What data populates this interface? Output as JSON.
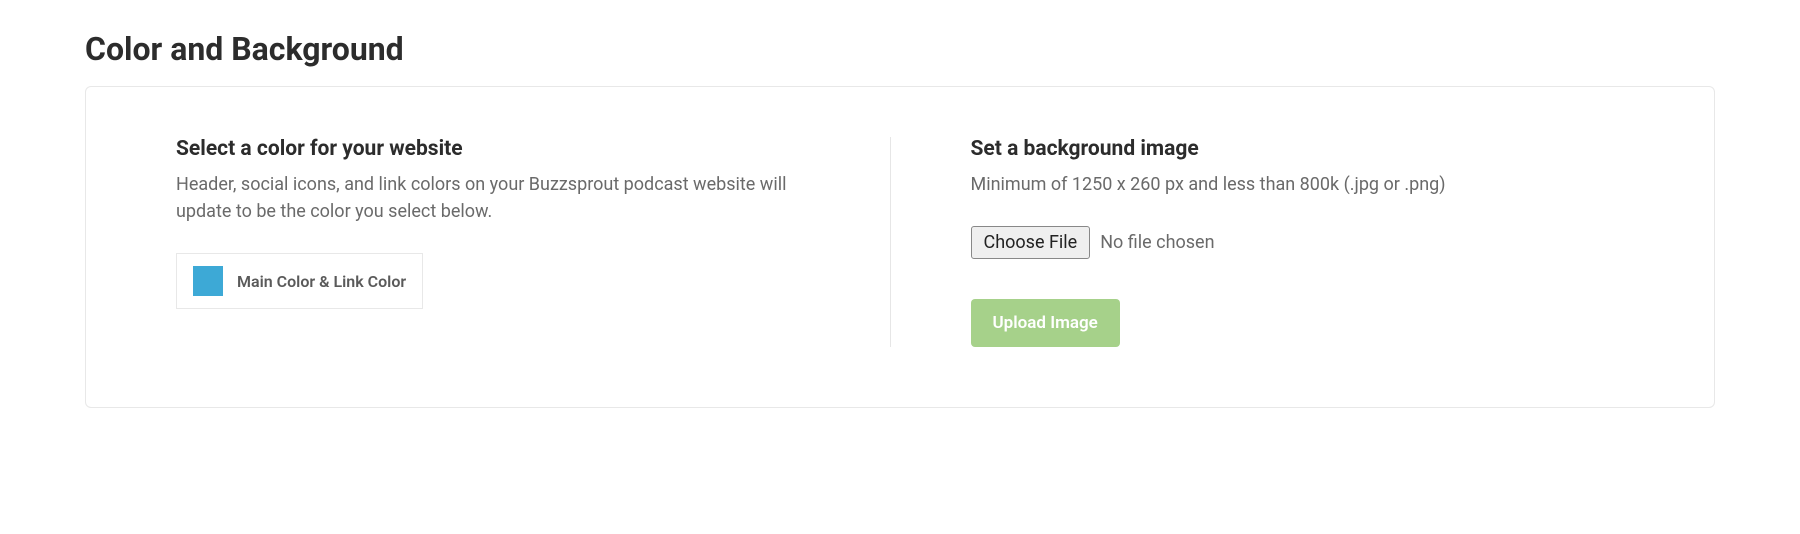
{
  "page_title": "Color and Background",
  "left": {
    "heading": "Select a color for your website",
    "description": "Header, social icons, and link colors on your Buzzsprout podcast website will update to be the color you select below.",
    "color_swatch_hex": "#3da9d6",
    "color_label": "Main Color & Link Color"
  },
  "right": {
    "heading": "Set a background image",
    "description": "Minimum of 1250 x 260 px and less than 800k (.jpg or .png)",
    "choose_file_label": "Choose File",
    "file_status": "No file chosen",
    "upload_button_label": "Upload Image"
  }
}
